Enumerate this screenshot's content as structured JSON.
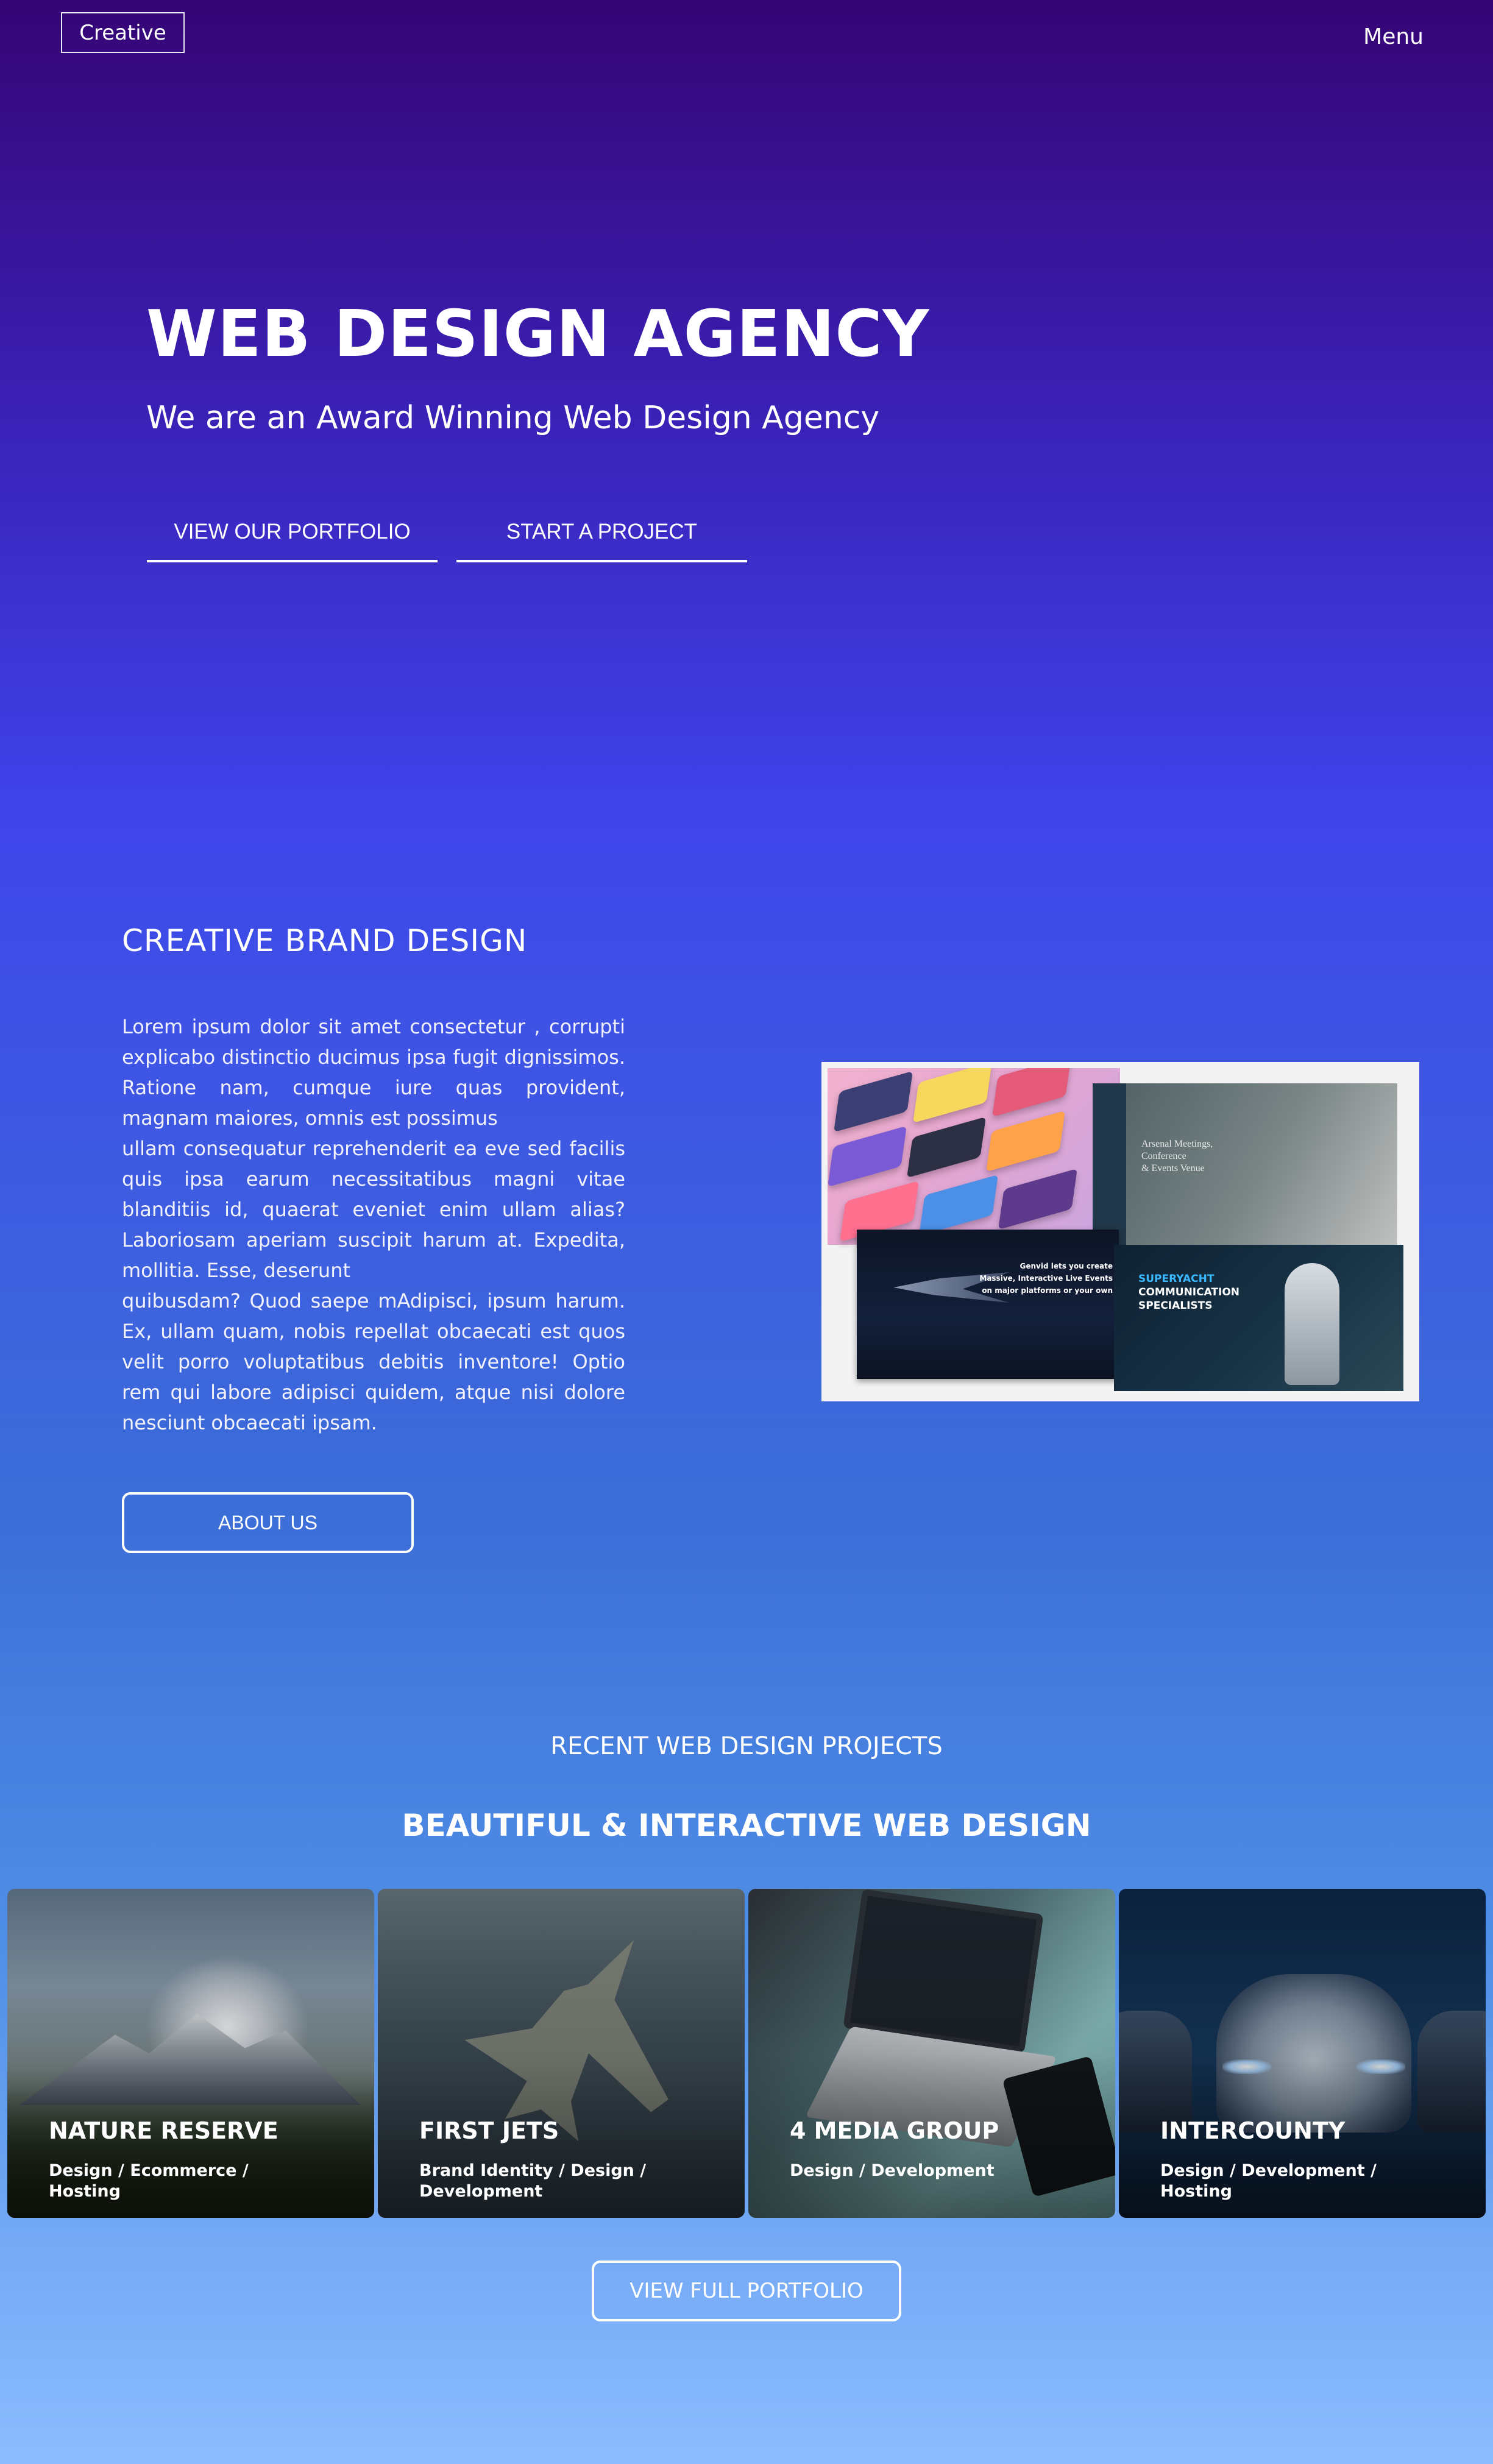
{
  "header": {
    "logo_label": "Creative",
    "menu_label": "Menu"
  },
  "hero": {
    "title": "WEB DESIGN AGENCY",
    "subtitle": "We are an Award Winning Web Design Agency",
    "buttons": {
      "portfolio": "VIEW OUR PORTFOLIO",
      "project": "START A PROJECT"
    }
  },
  "brand": {
    "title": "CREATIVE BRAND DESIGN",
    "paragraphs": [
      "Lorem ipsum dolor sit amet consectetur , corrupti explicabo distinctio ducimus ipsa fugit dignissimos. Ratione nam, cumque iure quas provident, magnam maiores, omnis est possimus",
      "ullam consequatur reprehenderit ea eve sed facilis quis ipsa earum necessitatibus magni vitae blanditiis id, quaerat eveniet enim ullam alias? Laboriosam aperiam suscipit harum at. Expedita, mollitia. Esse, deserunt",
      "quibusdam? Quod saepe mAdipisci, ipsum harum. Ex, ullam quam, nobis repellat obcaecati est quos velit porro voluptatibus debitis inventore! Optio rem qui labore adipisci quidem, atque nisi dolore nesciunt obcaecati ipsam."
    ],
    "about_button": "ABOUT US",
    "collage": {
      "caption_arsenal": "Arsenal Meetings,\nConference\n& Events Venue",
      "caption_jet": "Genvid lets you create\nMassive, Interactive Live Events\non major platforms or your own",
      "caption_yacht_line1": "SUPERYACHT",
      "caption_yacht_line2": "COMMUNICATION",
      "caption_yacht_line3": "SPECIALISTS"
    }
  },
  "projects": {
    "kicker": "RECENT WEB DESIGN PROJECTS",
    "heading": "BEAUTIFUL & INTERACTIVE WEB DESIGN",
    "cards": [
      {
        "title": "NATURE RESERVE",
        "tags": "Design / Ecommerce / Hosting"
      },
      {
        "title": "FIRST JETS",
        "tags": "Brand Identity / Design / Development"
      },
      {
        "title": "4 MEDIA GROUP",
        "tags": "Design / Development"
      },
      {
        "title": "INTERCOUNTY",
        "tags": "Design / Development / Hosting"
      }
    ],
    "full_portfolio_button": "VIEW FULL PORTFOLIO"
  },
  "colors": {
    "gradient_top": "#350575",
    "gradient_mid": "#3f43ea",
    "gradient_bottom": "#8bbcff",
    "text": "#ffffff"
  }
}
